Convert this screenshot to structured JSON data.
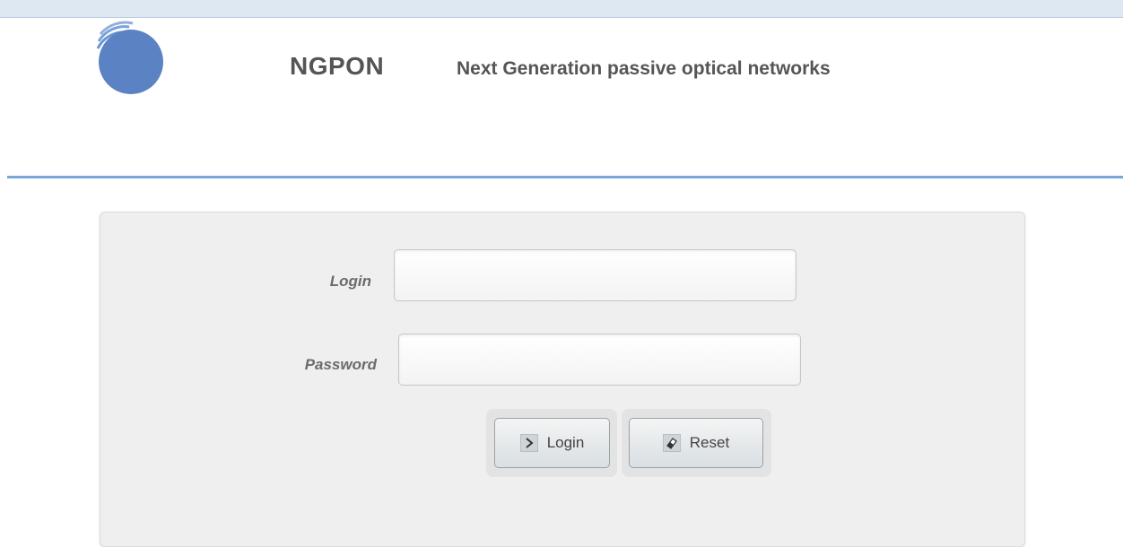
{
  "header": {
    "brand": "NGPON",
    "tagline": "Next Generation passive optical networks"
  },
  "form": {
    "login_label": "Login",
    "password_label": "Password",
    "login_value": "",
    "password_value": "",
    "login_button": "Login",
    "reset_button": "Reset"
  },
  "colors": {
    "accent": "#7aa7d6",
    "logo": "#5b82c3"
  },
  "icons": {
    "logo": "circle-logo-icon",
    "login": "chevron-right-icon",
    "reset": "eraser-icon"
  }
}
